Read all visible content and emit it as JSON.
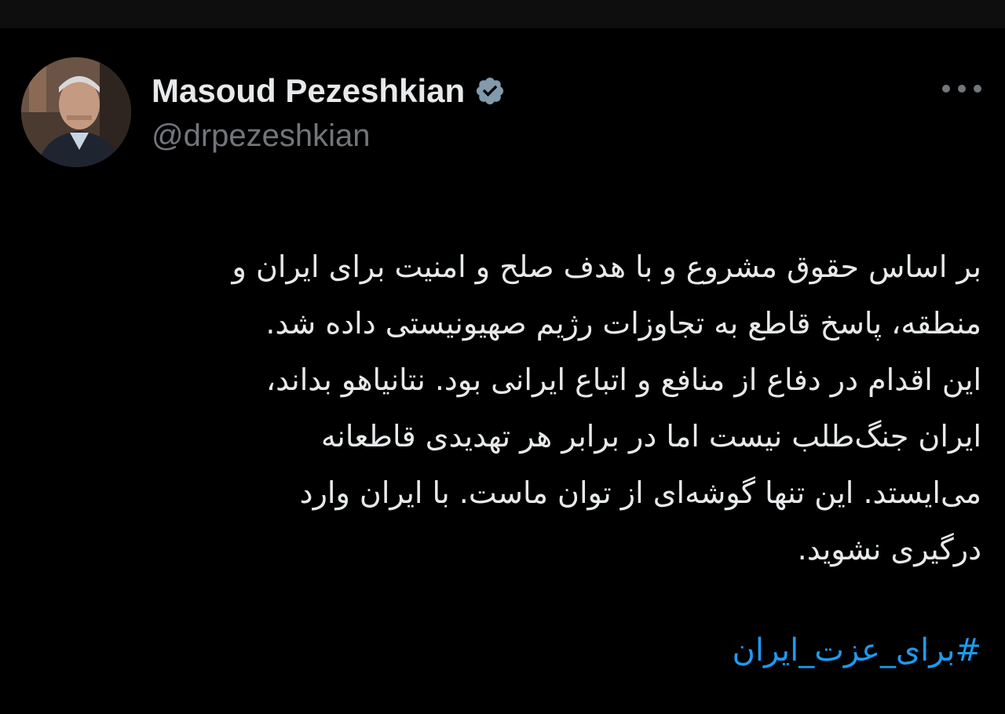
{
  "author": {
    "display_name": "Masoud Pezeshkian",
    "handle": "@drpezeshkian",
    "verified_badge_icon": "verified-badge-icon",
    "verified_color": "#829aab"
  },
  "tweet": {
    "lines": [
      "بر اساس حقوق مشروع و با هدف صلح و امنیت برای ایران و",
      "منطقه، پاسخ قاطع به تجاوزات رژیم صهیونیستی داده شد.",
      "این اقدام در دفاع از منافع و اتباع ایرانی بود. نتانیاهو بداند،",
      "ایران جنگ‌طلب نیست اما در برابر هر تهدیدی قاطعانه",
      "می‌ایستد. این تنها گوشه‌ای از توان ماست. با ایران وارد",
      "درگیری نشوید."
    ],
    "hashtag": "#برای_عزت_ایران"
  },
  "more_menu_icon": "more-horizontal-icon",
  "colors": {
    "background": "#000000",
    "text": "#e7e9ea",
    "secondary": "#71767b",
    "link": "#1d9bf0"
  }
}
